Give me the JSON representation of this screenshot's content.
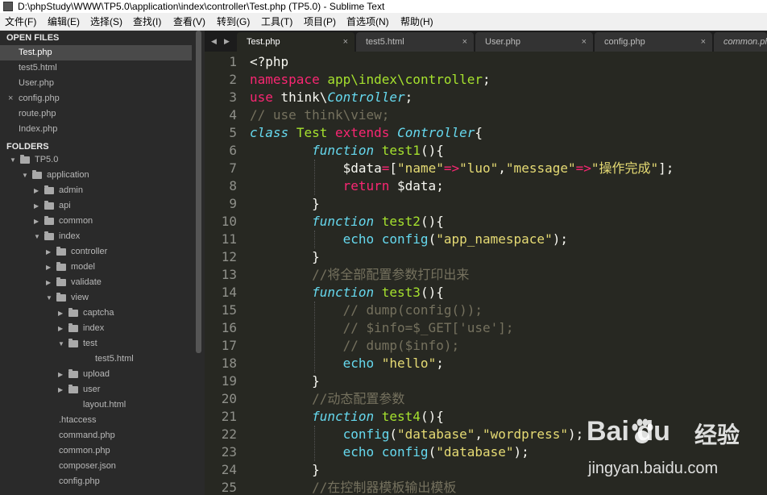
{
  "window": {
    "title": "D:\\phpStudy\\WWW\\TP5.0\\application\\index\\controller\\Test.php (TP5.0) - Sublime Text"
  },
  "menubar": {
    "items": [
      "文件(F)",
      "编辑(E)",
      "选择(S)",
      "查找(I)",
      "查看(V)",
      "转到(G)",
      "工具(T)",
      "项目(P)",
      "首选项(N)",
      "帮助(H)"
    ]
  },
  "sidebar": {
    "open_files_header": "OPEN FILES",
    "open_files": [
      "Test.php",
      "test5.html",
      "User.php",
      "config.php",
      "route.php",
      "Index.php"
    ],
    "active_open_file": 0,
    "modified_open_file": 3,
    "folders_header": "FOLDERS",
    "tree": [
      {
        "label": "TP5.0",
        "depth": 0,
        "kind": "folder",
        "open": true
      },
      {
        "label": "application",
        "depth": 1,
        "kind": "folder",
        "open": true
      },
      {
        "label": "admin",
        "depth": 2,
        "kind": "folder",
        "open": false
      },
      {
        "label": "api",
        "depth": 2,
        "kind": "folder",
        "open": false
      },
      {
        "label": "common",
        "depth": 2,
        "kind": "folder",
        "open": false
      },
      {
        "label": "index",
        "depth": 2,
        "kind": "folder",
        "open": true
      },
      {
        "label": "controller",
        "depth": 3,
        "kind": "folder",
        "open": false
      },
      {
        "label": "model",
        "depth": 3,
        "kind": "folder",
        "open": false
      },
      {
        "label": "validate",
        "depth": 3,
        "kind": "folder",
        "open": false
      },
      {
        "label": "view",
        "depth": 3,
        "kind": "folder",
        "open": true
      },
      {
        "label": "captcha",
        "depth": 4,
        "kind": "folder",
        "open": false
      },
      {
        "label": "index",
        "depth": 4,
        "kind": "folder",
        "open": false
      },
      {
        "label": "test",
        "depth": 4,
        "kind": "folder",
        "open": true
      },
      {
        "label": "test5.html",
        "depth": 5,
        "kind": "file"
      },
      {
        "label": "upload",
        "depth": 4,
        "kind": "folder",
        "open": false
      },
      {
        "label": "user",
        "depth": 4,
        "kind": "folder",
        "open": false
      },
      {
        "label": "layout.html",
        "depth": 4,
        "kind": "file"
      },
      {
        "label": ".htaccess",
        "depth": 2,
        "kind": "file"
      },
      {
        "label": "command.php",
        "depth": 2,
        "kind": "file"
      },
      {
        "label": "common.php",
        "depth": 2,
        "kind": "file"
      },
      {
        "label": "composer.json",
        "depth": 2,
        "kind": "file"
      },
      {
        "label": "config.php",
        "depth": 2,
        "kind": "file"
      }
    ]
  },
  "tabs": [
    {
      "label": "Test.php",
      "active": true
    },
    {
      "label": "test5.html",
      "active": false
    },
    {
      "label": "User.php",
      "active": false
    },
    {
      "label": "config.php",
      "active": false
    },
    {
      "label": "common.ph",
      "active": false
    }
  ],
  "tab_close_glyph": "×",
  "tab_nav": {
    "left": "◀",
    "right": "▶"
  },
  "code_lines": [
    [
      [
        "w",
        "<?php"
      ]
    ],
    [
      [
        "k",
        "namespace"
      ],
      [
        "w",
        " "
      ],
      [
        "t",
        "app\\index\\controller"
      ],
      [
        "w",
        ";"
      ]
    ],
    [
      [
        "k",
        "use"
      ],
      [
        "w",
        " think\\"
      ],
      [
        "i",
        "Controller"
      ],
      [
        "w",
        ";"
      ]
    ],
    [
      [
        "c",
        "// use think\\view;"
      ]
    ],
    [
      [
        "i",
        "class"
      ],
      [
        "w",
        " "
      ],
      [
        "t",
        "Test"
      ],
      [
        "w",
        " "
      ],
      [
        "k",
        "extends"
      ],
      [
        "w",
        " "
      ],
      [
        "i",
        "Controller"
      ],
      [
        "w",
        "{"
      ]
    ],
    [
      [
        "w",
        "        "
      ],
      [
        "i",
        "function"
      ],
      [
        "w",
        " "
      ],
      [
        "t",
        "test1"
      ],
      [
        "w",
        "(){"
      ]
    ],
    [
      [
        "w",
        "            $data"
      ],
      [
        "k",
        "="
      ],
      [
        "w",
        "["
      ],
      [
        "s",
        "\"name\""
      ],
      [
        "k",
        "=>"
      ],
      [
        "s",
        "\"luo\""
      ],
      [
        "w",
        ","
      ],
      [
        "s",
        "\"message\""
      ],
      [
        "k",
        "=>"
      ],
      [
        "s",
        "\"操作完成\""
      ],
      [
        "w",
        "];"
      ]
    ],
    [
      [
        "w",
        "            "
      ],
      [
        "k",
        "return"
      ],
      [
        "w",
        " $data;"
      ]
    ],
    [
      [
        "w",
        "        }"
      ]
    ],
    [
      [
        "w",
        "        "
      ],
      [
        "i",
        "function"
      ],
      [
        "w",
        " "
      ],
      [
        "t",
        "test2"
      ],
      [
        "w",
        "(){"
      ]
    ],
    [
      [
        "w",
        "            "
      ],
      [
        "f",
        "echo"
      ],
      [
        "w",
        " "
      ],
      [
        "f",
        "config"
      ],
      [
        "w",
        "("
      ],
      [
        "s",
        "\"app_namespace\""
      ],
      [
        "w",
        ");"
      ]
    ],
    [
      [
        "w",
        "        }"
      ]
    ],
    [
      [
        "w",
        "        "
      ],
      [
        "c",
        "//将全部配置参数打印出来"
      ]
    ],
    [
      [
        "w",
        "        "
      ],
      [
        "i",
        "function"
      ],
      [
        "w",
        " "
      ],
      [
        "t",
        "test3"
      ],
      [
        "w",
        "(){"
      ]
    ],
    [
      [
        "w",
        "            "
      ],
      [
        "c",
        "// dump(config());"
      ]
    ],
    [
      [
        "w",
        "            "
      ],
      [
        "c",
        "// $info=$_GET['use'];"
      ]
    ],
    [
      [
        "w",
        "            "
      ],
      [
        "c",
        "// dump($info);"
      ]
    ],
    [
      [
        "w",
        "            "
      ],
      [
        "f",
        "echo"
      ],
      [
        "w",
        " "
      ],
      [
        "s",
        "\"hello\""
      ],
      [
        "w",
        ";"
      ]
    ],
    [
      [
        "w",
        "        }"
      ]
    ],
    [
      [
        "w",
        "        "
      ],
      [
        "c",
        "//动态配置参数"
      ]
    ],
    [
      [
        "w",
        "        "
      ],
      [
        "i",
        "function"
      ],
      [
        "w",
        " "
      ],
      [
        "t",
        "test4"
      ],
      [
        "w",
        "(){"
      ]
    ],
    [
      [
        "w",
        "            "
      ],
      [
        "f",
        "config"
      ],
      [
        "w",
        "("
      ],
      [
        "s",
        "\"database\""
      ],
      [
        "w",
        ","
      ],
      [
        "s",
        "\"wordpress\""
      ],
      [
        "w",
        ");"
      ]
    ],
    [
      [
        "w",
        "            "
      ],
      [
        "f",
        "echo"
      ],
      [
        "w",
        " "
      ],
      [
        "f",
        "config"
      ],
      [
        "w",
        "("
      ],
      [
        "s",
        "\"database\""
      ],
      [
        "w",
        ");"
      ]
    ],
    [
      [
        "w",
        "        }"
      ]
    ],
    [
      [
        "w",
        "        "
      ],
      [
        "c",
        "//在控制器模板输出模板"
      ]
    ]
  ],
  "watermark": {
    "brand": "Bai du",
    "jingyan": "经验",
    "domain": "jingyan.baidu.com"
  },
  "colors": {
    "keyword": "#f92672",
    "string": "#e6db74",
    "comment": "#75715e",
    "entity": "#a6e22e",
    "storage": "#66d9ef",
    "background": "#272822",
    "sidebar": "#2a2a2a"
  }
}
